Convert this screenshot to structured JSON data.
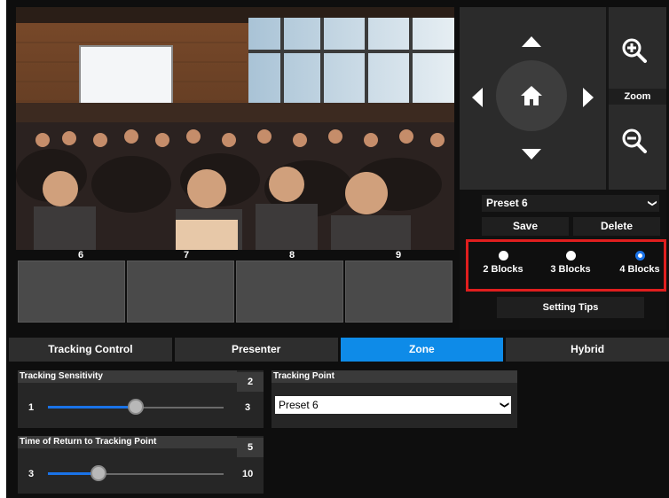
{
  "video": {
    "block_labels": [
      "6",
      "7",
      "8",
      "9"
    ]
  },
  "ptz": {
    "zoom_label": "Zoom"
  },
  "preset": {
    "selected": "Preset 6",
    "save_label": "Save",
    "delete_label": "Delete",
    "block_options": [
      {
        "label": "2 Blocks",
        "checked": false
      },
      {
        "label": "3 Blocks",
        "checked": false
      },
      {
        "label": "4 Blocks",
        "checked": true
      }
    ],
    "setting_tips_label": "Setting Tips"
  },
  "tabs": [
    {
      "label": "Tracking Control",
      "active": false
    },
    {
      "label": "Presenter",
      "active": false
    },
    {
      "label": "Zone",
      "active": true
    },
    {
      "label": "Hybrid",
      "active": false
    }
  ],
  "sensitivity": {
    "title": "Tracking Sensitivity",
    "value": "2",
    "min": "1",
    "max": "3",
    "level": 2
  },
  "return_time": {
    "title": "Time of Return to Tracking Point",
    "value": "5",
    "min": "3",
    "max": "10",
    "level": 5
  },
  "tracking_point": {
    "title": "Tracking Point",
    "selected": "Preset 6"
  },
  "colors": {
    "accent": "#0e8be8",
    "highlight_border": "#e01e1e",
    "background": "#0e0e0e"
  },
  "icons": {
    "home": "home-icon",
    "zoom_in": "zoom-in-icon",
    "zoom_out": "zoom-out-icon"
  }
}
